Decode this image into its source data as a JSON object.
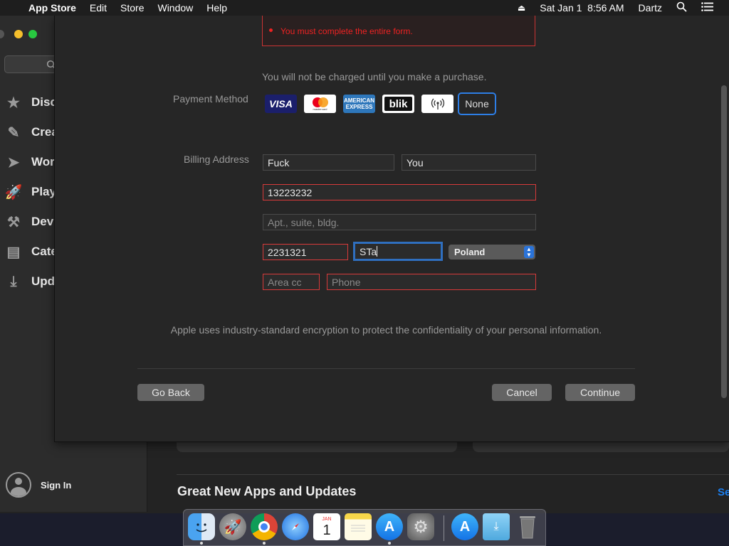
{
  "menubar": {
    "app_name": "App Store",
    "items": [
      "Edit",
      "Store",
      "Window",
      "Help"
    ],
    "datetime": "Sat Jan 1  8:56 AM",
    "user": "Dartz"
  },
  "sidebar": {
    "items": [
      {
        "label": "Disc",
        "icon": "star-icon"
      },
      {
        "label": "Crea",
        "icon": "brush-icon"
      },
      {
        "label": "Wor",
        "icon": "paper-plane-icon"
      },
      {
        "label": "Play",
        "icon": "rocket-icon"
      },
      {
        "label": "Dev",
        "icon": "hammer-icon"
      },
      {
        "label": "Cate",
        "icon": "categories-icon"
      },
      {
        "label": "Upd",
        "icon": "download-icon"
      }
    ],
    "sign_in": "Sign In"
  },
  "main": {
    "section_title": "Great New Apps and Updates",
    "see_all": "Se"
  },
  "sheet": {
    "error": "You must complete the entire form.",
    "charge_note": "You will not be charged until you make a purchase.",
    "payment_label": "Payment Method",
    "payment_methods": [
      {
        "label": "VISA",
        "icon": "visa-icon"
      },
      {
        "label": "mastercard",
        "icon": "mastercard-icon"
      },
      {
        "label": "AMERICAN EXPRESS",
        "icon": "amex-icon"
      },
      {
        "label": "blik",
        "icon": "blik-icon"
      },
      {
        "label": "",
        "icon": "contactless-icon"
      },
      {
        "label": "None",
        "icon": ""
      }
    ],
    "billing_label": "Billing Address",
    "first_name": "Fuck",
    "last_name": "You",
    "street": "13223232",
    "apt_placeholder": "Apt., suite, bldg.",
    "postal": "2231321",
    "city": "STa",
    "country": "Poland",
    "area_code_placeholder": "Area cc",
    "phone_placeholder": "Phone",
    "encryption_note": "Apple uses industry-standard encryption to protect the confidentiality of your personal information.",
    "go_back": "Go Back",
    "cancel": "Cancel",
    "continue": "Continue"
  },
  "dock": {
    "calendar_month": "JAN",
    "calendar_day": "1"
  },
  "colors": {
    "error": "#e22222",
    "focus": "#2f6fbf",
    "accent": "#1a7ff0"
  }
}
